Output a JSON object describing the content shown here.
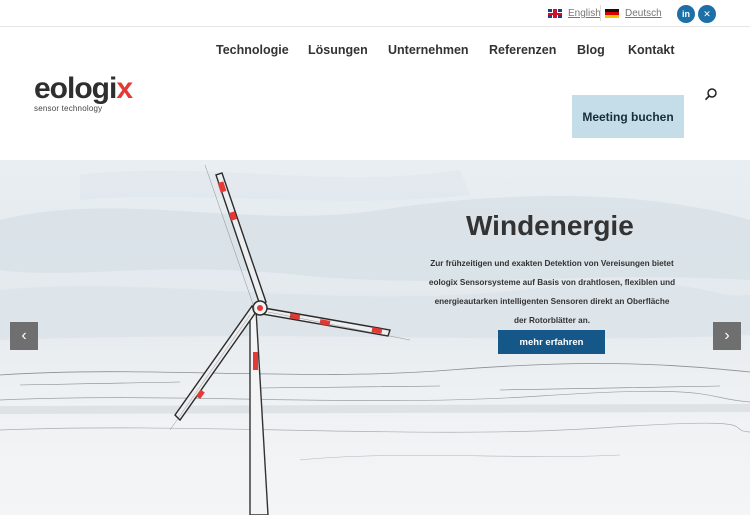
{
  "topbar": {
    "lang_en": "English",
    "lang_de": "Deutsch",
    "social_linkedin": "in",
    "social_xing": "✕"
  },
  "nav": {
    "items": [
      "Technologie",
      "Lösungen",
      "Unternehmen",
      "Referenzen",
      "Blog",
      "Kontakt"
    ]
  },
  "logo": {
    "word_main": "eologi",
    "word_accent": "x",
    "tagline": "sensor technology"
  },
  "header": {
    "meeting_button": "Meeting buchen"
  },
  "hero": {
    "title": "Windenergie",
    "text": "Zur frühzeitigen und exakten Detektion von Vereisungen bietet eologix Sensorsysteme auf Basis von drahtlosen, flexiblen und energieautarken intelligenten Sensoren direkt an Oberfläche der Rotorblätter an.",
    "button": "mehr erfahren",
    "prev_arrow": "‹",
    "next_arrow": "›"
  },
  "colors": {
    "accent_red": "#e53935",
    "button_blue": "#16578a",
    "meeting_bg": "#c4dde9",
    "social_blue": "#1d6fa8"
  }
}
